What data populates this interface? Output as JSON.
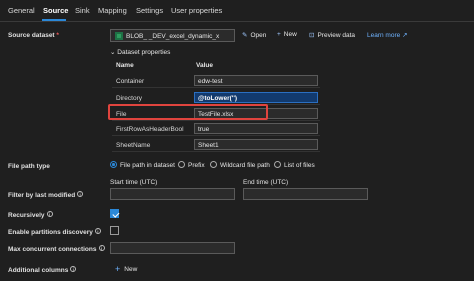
{
  "tabs": [
    {
      "label": "General"
    },
    {
      "label": "Source"
    },
    {
      "label": "Sink"
    },
    {
      "label": "Mapping"
    },
    {
      "label": "Settings"
    },
    {
      "label": "User properties"
    }
  ],
  "source_dataset": {
    "label": "Source dataset",
    "required_mark": "*",
    "value": "BLOB_          _DEV_excel_dynamic_x",
    "actions": {
      "open": "Open",
      "new": "New",
      "preview": "Preview data",
      "learn_more": "Learn more"
    }
  },
  "dataset_properties": {
    "title": "Dataset properties",
    "col_name": "Name",
    "col_value": "Value",
    "rows": [
      {
        "name": "Container",
        "value": "edw-test"
      },
      {
        "name": "Directory",
        "value": "@toLower('')"
      },
      {
        "name": "File",
        "value": "TestFile.xlsx"
      },
      {
        "name": "FirstRowAsHeaderBool",
        "value": "true"
      },
      {
        "name": "SheetName",
        "value": "Sheet1"
      }
    ]
  },
  "file_path_type": {
    "label": "File path type",
    "options": [
      {
        "label": "File path in dataset",
        "selected": true
      },
      {
        "label": "Prefix",
        "selected": false
      },
      {
        "label": "Wildcard file path",
        "selected": false
      },
      {
        "label": "List of files",
        "selected": false
      }
    ]
  },
  "filter_modified": {
    "label": "Filter by last modified",
    "start_label": "Start time (UTC)",
    "end_label": "End time (UTC)",
    "start_value": "",
    "end_value": ""
  },
  "recursively": {
    "label": "Recursively",
    "checked": true
  },
  "partitions": {
    "label": "Enable partitions discovery",
    "checked": false
  },
  "max_connections": {
    "label": "Max concurrent connections",
    "value": ""
  },
  "additional_columns": {
    "label": "Additional columns",
    "new_label": "New"
  },
  "colors": {
    "accent": "#2b88d8",
    "highlight": "#e0443e",
    "background": "#1f1f1f"
  }
}
